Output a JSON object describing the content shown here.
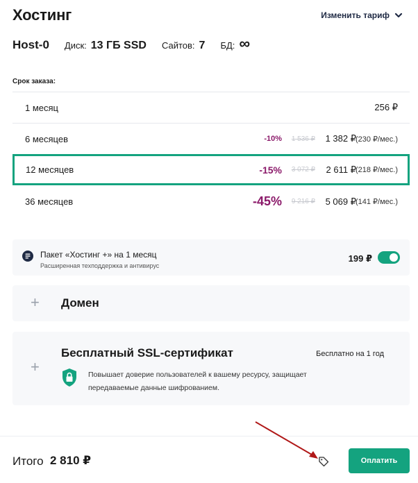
{
  "header": {
    "title": "Хостинг",
    "change_plan": "Изменить тариф"
  },
  "plan": {
    "name": "Host-0",
    "disk_label": "Диск:",
    "disk_value": "13 ГБ SSD",
    "sites_label": "Сайтов:",
    "sites_value": "7",
    "db_label": "БД:",
    "db_value": "∞"
  },
  "period_label": "Срок заказа:",
  "periods": [
    {
      "name": "1 месяц",
      "price": "256 ₽",
      "selected": false
    },
    {
      "name": "6 месяцев",
      "discount": "-10%",
      "old_price": "1 536 ₽",
      "price": "1 382 ₽",
      "monthly": "(230 ₽/мес.)",
      "selected": false
    },
    {
      "name": "12 месяцев",
      "discount": "-15%",
      "old_price": "3 072 ₽",
      "price": "2 611 ₽",
      "monthly": "(218 ₽/мес.)",
      "selected": true
    },
    {
      "name": "36 месяцев",
      "discount": "-45%",
      "old_price": "9 216 ₽",
      "price": "5 069 ₽",
      "monthly": "(141 ₽/мес.)",
      "selected": false
    }
  ],
  "addon": {
    "icon": "support-icon",
    "title": "Пакет «Хостинг +» на 1 месяц",
    "subtitle": "Расширенная техподдержка и антивирус",
    "price": "199 ₽",
    "enabled": true
  },
  "domain": {
    "title": "Домен",
    "icon": "plus-icon"
  },
  "ssl": {
    "title": "Бесплатный SSL-сертификат",
    "badge": "Бесплатно на 1 год",
    "description": "Повышает доверие пользователей к вашему ресурсу, защищает передаваемые данные шифрованием.",
    "icon": "lock-shield-icon"
  },
  "footer": {
    "total_label": "Итого",
    "total_value": "2 810 ₽",
    "promo_icon": "tag-icon",
    "pay_button": "Оплатить"
  },
  "colors": {
    "accent": "#14a37f",
    "discount": "#8b1a6a",
    "annotation_arrow": "#b01818"
  }
}
